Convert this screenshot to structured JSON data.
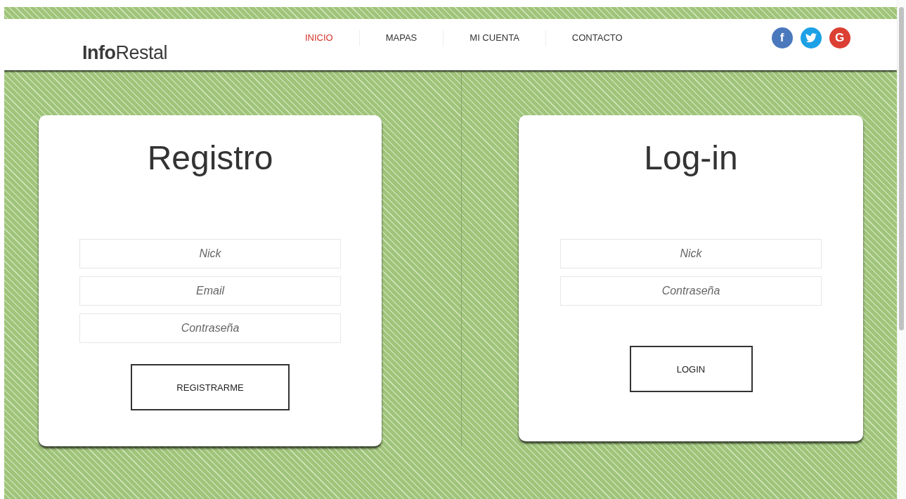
{
  "header": {
    "logo": "**Info**Restal",
    "nav": [
      {
        "label": "INICIO",
        "selected": true
      },
      {
        "label": "MAPAS",
        "selected": false
      },
      {
        "label": "MI CUENTA",
        "selected": false
      },
      {
        "label": "CONTACTO",
        "selected": false
      }
    ],
    "social": [
      {
        "kind": "facebook",
        "glyph": "f",
        "color": "#4a78bd"
      },
      {
        "kind": "twitter",
        "color": "#1da1e6"
      },
      {
        "kind": "google",
        "glyph": "G",
        "color": "#dc3f33"
      }
    ]
  },
  "forms": [
    {
      "title": "Registro",
      "fields": [
        {
          "placeholder": "Nick"
        },
        {
          "placeholder": "Email"
        },
        {
          "placeholder": "Contraseña"
        }
      ],
      "button": "REGISTRARME"
    },
    {
      "title": "Log-in",
      "fields": [
        {
          "placeholder": "Nick"
        },
        {
          "placeholder": "Contraseña"
        }
      ],
      "button": "LOGIN"
    }
  ]
}
